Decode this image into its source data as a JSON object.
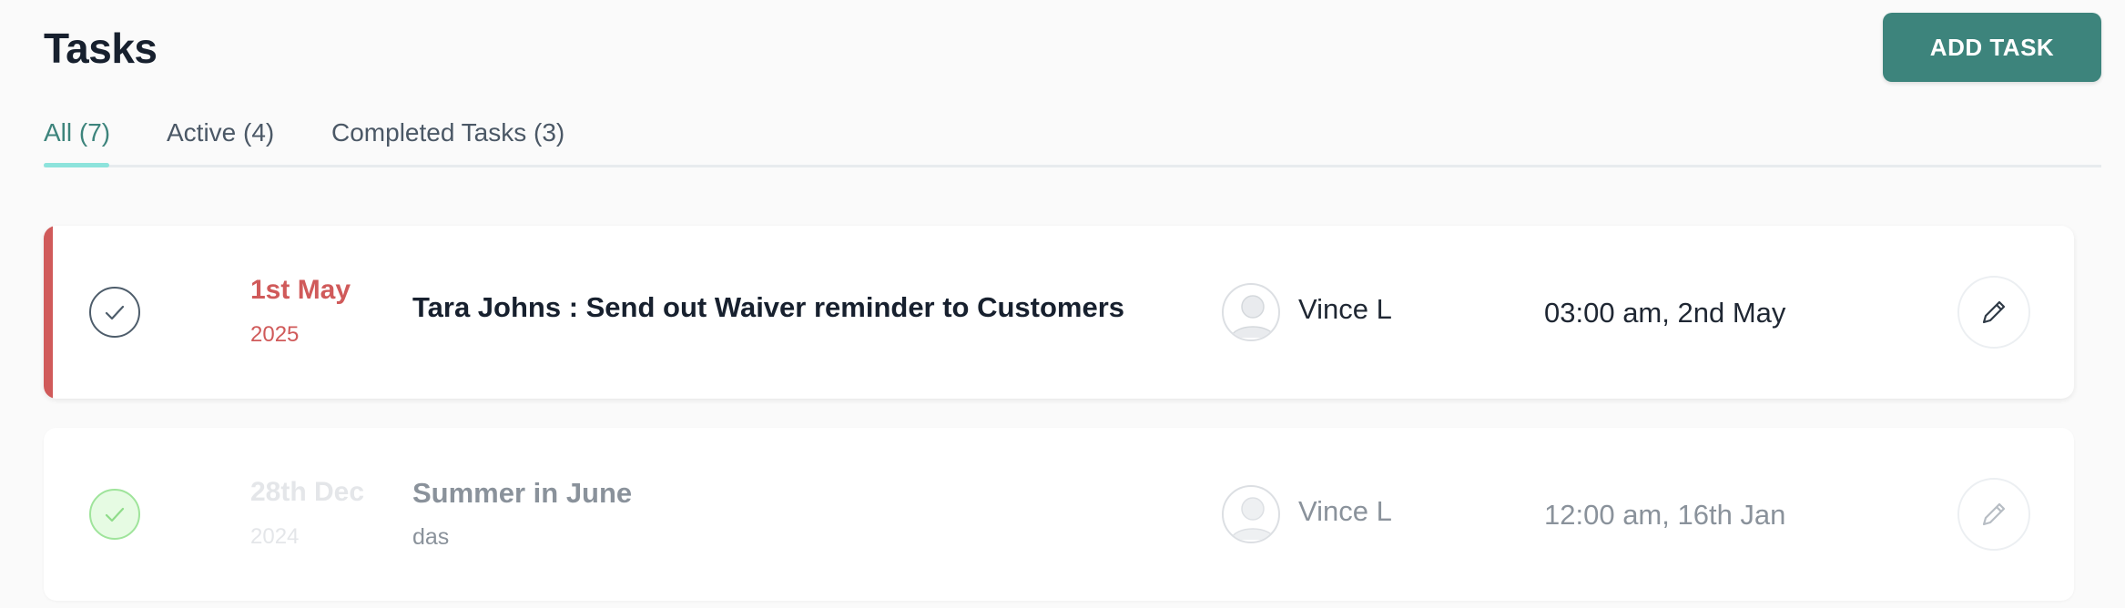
{
  "header": {
    "title": "Tasks",
    "add_task_label": "ADD TASK"
  },
  "tabs": [
    {
      "label": "All (7)",
      "active": true
    },
    {
      "label": "Active (4)",
      "active": false
    },
    {
      "label": "Completed Tasks (3)",
      "active": false
    }
  ],
  "colors": {
    "accent": "#3d847c",
    "overdue": "#d05a5a",
    "completed_check": "#9fe49b"
  },
  "tasks": [
    {
      "status": "active-overdue",
      "date": "1st May",
      "year": "2025",
      "title": "Tara Johns : Send out Waiver reminder to Customers",
      "description": "",
      "assignee": "Vince L",
      "due": "03:00 am, 2nd May",
      "check_icon": "check-icon",
      "edit_icon": "pencil-icon"
    },
    {
      "status": "completed",
      "date": "28th Dec",
      "year": "2024",
      "title": "Summer in June",
      "description": "das",
      "assignee": "Vince L",
      "due": "12:00 am, 16th Jan",
      "check_icon": "check-icon",
      "edit_icon": "pencil-icon"
    }
  ]
}
